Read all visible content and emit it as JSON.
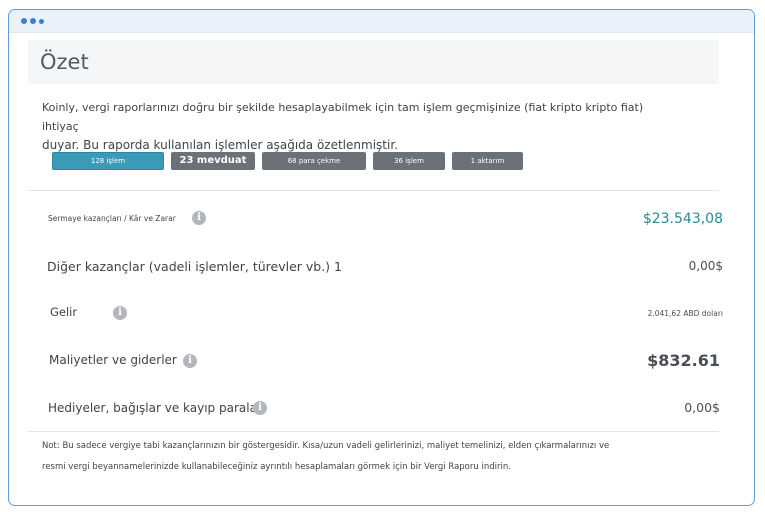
{
  "window": {
    "dots": [
      "window-dot-1",
      "window-dot-2",
      "window-dot-3"
    ]
  },
  "header": {
    "title": "Özet"
  },
  "intro": {
    "line1": "Koinly, vergi raporlarınızı doğru bir şekilde hesaplayabilmek için tam işlem geçmişinize (fiat kripto kripto fiat) ihtiyaç",
    "line2": "duyar. Bu raporda kullanılan işlemler aşağıda özetlenmiştir."
  },
  "tabs": [
    {
      "label": "128 işlem",
      "active": true
    },
    {
      "label": "23 mevduat",
      "active": false
    },
    {
      "label": "68 para çekme",
      "active": false
    },
    {
      "label": "36 işlem",
      "active": false
    },
    {
      "label": "1 aktarım",
      "active": false
    }
  ],
  "rows": [
    {
      "label": "Sermaye kazançları / Kâr ve Zarar",
      "info_icon": "info-icon",
      "value": "$23.543,08",
      "value_color": "#2a8a94"
    },
    {
      "label": "Diğer kazançlar (vadeli işlemler, türevler vb.) 1",
      "value": "0,00$"
    },
    {
      "label": "Gelir",
      "info_icon": "info-icon",
      "value": "2.041,62 ABD doları"
    },
    {
      "label": "Maliyetler ve giderler",
      "info_icon": "info-icon",
      "value": "$832.61"
    },
    {
      "label": "Hediyeler, bağışlar ve kayıp paralar",
      "info_icon": "info-icon",
      "value": "0,00$"
    }
  ],
  "note": {
    "line1": "Not: Bu sadece vergiye tabi kazançlarınızın bir göstergesidir. Kısa/uzun vadeli gelirlerinizi, maliyet temelinizi, elden çıkarmalarınızı ve",
    "line2": "resmi vergi beyannamelerinizde kullanabileceğiniz ayrıntılı hesaplamaları görmek için bir Vergi Raporu indirin."
  },
  "colors": {
    "accent": "#3a9ab8",
    "window_border": "#5b9de0",
    "pill": "#6c7178",
    "gain": "#2a8a94"
  }
}
